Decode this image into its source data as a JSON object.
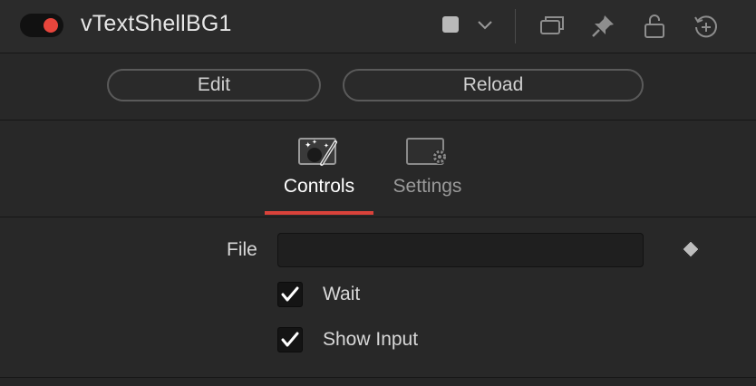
{
  "header": {
    "node_name": "vTextShellBG1",
    "toggle_color": "#e8453c",
    "icons": [
      "color-swatch",
      "chevron-down-icon",
      "copy-window-icon",
      "pin-icon",
      "lock-icon",
      "reset-icon"
    ]
  },
  "buttons": {
    "edit_label": "Edit",
    "reload_label": "Reload"
  },
  "tabs": [
    {
      "label": "Controls",
      "icon": "magic-wand-icon",
      "active": true
    },
    {
      "label": "Settings",
      "icon": "settings-gear-icon",
      "active": false
    }
  ],
  "controls": {
    "file": {
      "label": "File",
      "value": "",
      "placeholder": ""
    },
    "checkboxes": [
      {
        "label": "Wait",
        "checked": true
      },
      {
        "label": "Show Input",
        "checked": true
      }
    ]
  },
  "colors": {
    "accent": "#d9423a",
    "background": "#282828"
  }
}
